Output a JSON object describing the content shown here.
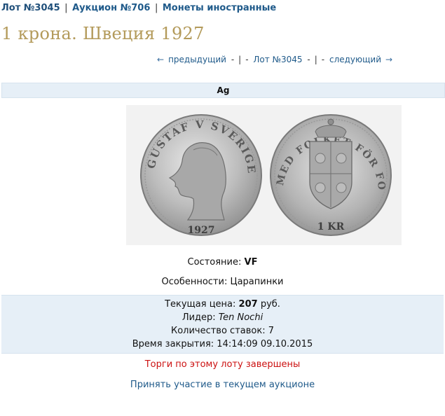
{
  "breadcrumb": {
    "lot": "Лот №3045",
    "sep1": "|",
    "auction": "Аукцион №706",
    "sep2": "|",
    "category": "Монеты иностранные"
  },
  "title": "1 крона. Швеция 1927",
  "lot_nav": {
    "prev_arrow": "←",
    "prev": "предыдущий",
    "sep1": "-",
    "sep2": "|",
    "sep3": "-",
    "current": "Лот №3045",
    "sep4": "-",
    "sep5": "|",
    "sep6": "-",
    "next": "следующий",
    "next_arrow": "→"
  },
  "metal": "Ag",
  "coin": {
    "obverse_legend": "GUSTAF V SVERIGES KONUNG",
    "obverse_year": "1927",
    "reverse_legend": "MED FOLKET FÖR FOSTERLANDET",
    "reverse_value": "1 KR"
  },
  "condition": {
    "label": "Состояние:",
    "value": "VF"
  },
  "features": {
    "label": "Особенности:",
    "value": "Царапинки"
  },
  "info": {
    "price_label": "Текущая цена:",
    "price_value": "207",
    "price_unit": "руб.",
    "leader_label": "Лидер:",
    "leader_value": "Ten Nochi",
    "bids_label": "Количество ставок:",
    "bids_value": "7",
    "close_label": "Время закрытия:",
    "close_value": "14:14:09 09.10.2015"
  },
  "status": "Торги по этому лоту завершены",
  "join_link": "Принять участие в текущем аукционе",
  "colors": {
    "link": "#1f5a8a",
    "title": "#b39a5a",
    "panel": "#e6eff7",
    "status": "#cc1111"
  }
}
